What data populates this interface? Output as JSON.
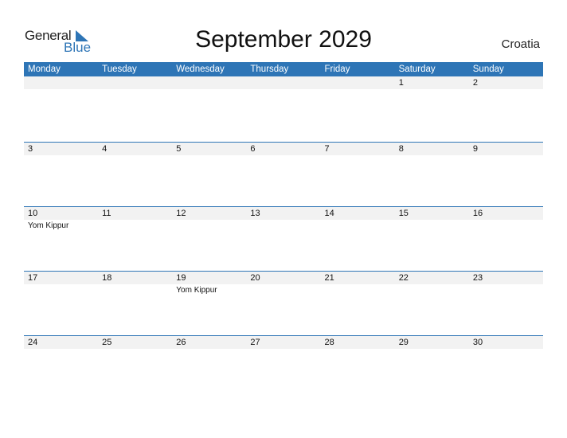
{
  "logo": {
    "general": "General",
    "blue": "Blue"
  },
  "title": "September 2029",
  "country": "Croatia",
  "colors": {
    "accent": "#2E75B6",
    "band": "#F2F2F2"
  },
  "weekdays": [
    "Monday",
    "Tuesday",
    "Wednesday",
    "Thursday",
    "Friday",
    "Saturday",
    "Sunday"
  ],
  "weeks": [
    [
      {
        "d": ""
      },
      {
        "d": ""
      },
      {
        "d": ""
      },
      {
        "d": ""
      },
      {
        "d": ""
      },
      {
        "d": "1"
      },
      {
        "d": "2"
      }
    ],
    [
      {
        "d": "3"
      },
      {
        "d": "4"
      },
      {
        "d": "5"
      },
      {
        "d": "6"
      },
      {
        "d": "7"
      },
      {
        "d": "8"
      },
      {
        "d": "9"
      }
    ],
    [
      {
        "d": "10",
        "e": "Yom Kippur"
      },
      {
        "d": "11"
      },
      {
        "d": "12"
      },
      {
        "d": "13"
      },
      {
        "d": "14"
      },
      {
        "d": "15"
      },
      {
        "d": "16"
      }
    ],
    [
      {
        "d": "17"
      },
      {
        "d": "18"
      },
      {
        "d": "19",
        "e": "Yom Kippur"
      },
      {
        "d": "20"
      },
      {
        "d": "21"
      },
      {
        "d": "22"
      },
      {
        "d": "23"
      }
    ],
    [
      {
        "d": "24"
      },
      {
        "d": "25"
      },
      {
        "d": "26"
      },
      {
        "d": "27"
      },
      {
        "d": "28"
      },
      {
        "d": "29"
      },
      {
        "d": "30"
      }
    ]
  ]
}
